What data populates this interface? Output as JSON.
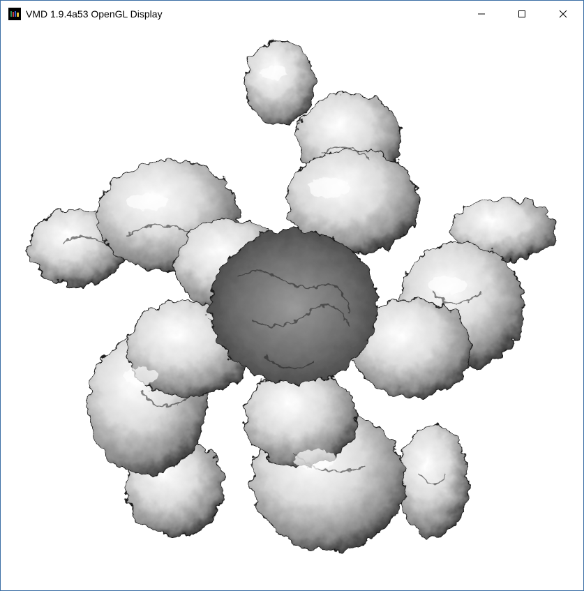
{
  "window": {
    "title": "VMD 1.9.4a53 OpenGL Display",
    "icon": "vmd-app-icon",
    "controls": {
      "minimize_icon": "minimize-icon",
      "maximize_icon": "maximize-icon",
      "close_icon": "close-icon"
    }
  },
  "display": {
    "background": "#ffffff",
    "surface_color": "#d8d8d8",
    "content": "grayscale molecular surface render"
  }
}
